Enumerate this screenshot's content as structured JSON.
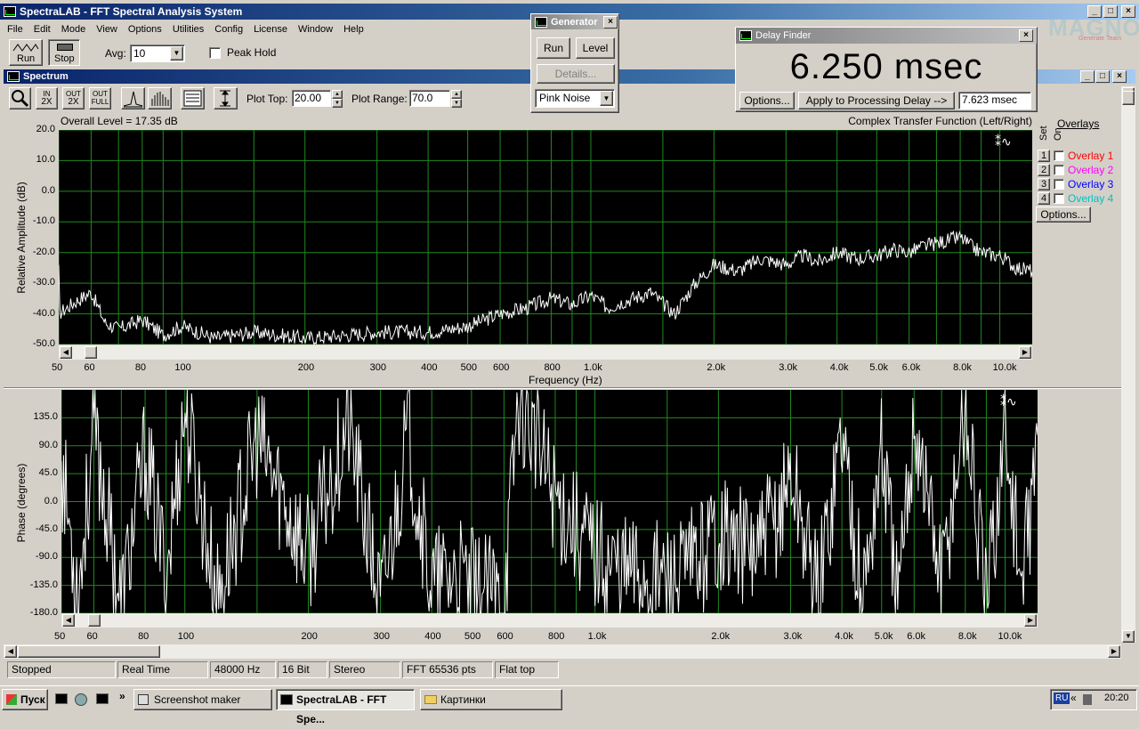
{
  "app": {
    "title": "SpectraLAB - FFT Spectral Analysis System",
    "watermark": "MAGNOLIA",
    "watermark_sub": "Generate Team"
  },
  "menu": [
    "File",
    "Edit",
    "Mode",
    "View",
    "Options",
    "Utilities",
    "Config",
    "License",
    "Window",
    "Help"
  ],
  "toolbar": {
    "run_label": "Run",
    "stop_label": "Stop",
    "avg_label": "Avg:",
    "avg_value": "10",
    "peak_hold_label": "Peak Hold"
  },
  "generator": {
    "title": "Generator",
    "run_label": "Run",
    "level_label": "Level",
    "details_label": "Details...",
    "signal_type": "Pink Noise"
  },
  "delay_finder": {
    "title": "Delay Finder",
    "readout": "6.250 msec",
    "options_label": "Options...",
    "apply_label": "Apply to Processing Delay -->",
    "value": "7.623 msec"
  },
  "spectrum": {
    "title": "Spectrum",
    "plot_top_label": "Plot Top:",
    "plot_top_value": "20.00",
    "plot_range_label": "Plot Range:",
    "plot_range_value": "70.0",
    "zoom_labels": {
      "in": "IN",
      "out": "OUT",
      "full": "FULL",
      "x2": "2X"
    },
    "overall_level": "Overall Level = 17.35 dB",
    "mode": "Complex Transfer Function (Left/Right)",
    "overlays": {
      "title": "Overlays",
      "set_label": "Set",
      "on_label": "On",
      "items": [
        {
          "num": "1",
          "label": "Overlay 1",
          "color": "#ff0000"
        },
        {
          "num": "2",
          "label": "Overlay 2",
          "color": "#ff00ff"
        },
        {
          "num": "3",
          "label": "Overlay 3",
          "color": "#0000ff"
        },
        {
          "num": "4",
          "label": "Overlay 4",
          "color": "#00c0c0"
        }
      ],
      "options_label": "Options..."
    }
  },
  "chart_data": [
    {
      "type": "line",
      "ylabel": "Relative Amplitude (dB)",
      "xlabel": "Frequency (Hz)",
      "xscale": "log",
      "xlim": [
        50,
        12000
      ],
      "ylim": [
        -50,
        20
      ],
      "yticks": [
        "20.0",
        "10.0",
        "0.0",
        "-10.0",
        "-20.0",
        "-30.0",
        "-40.0",
        "-50.0"
      ],
      "xticks": [
        "50",
        "60",
        "80",
        "100",
        "200",
        "300",
        "400",
        "500",
        "600",
        "800",
        "1.0k",
        "2.0k",
        "3.0k",
        "4.0k",
        "5.0k",
        "6.0k",
        "8.0k",
        "10.0k"
      ],
      "grid": true,
      "background": "#000000",
      "gridcolor": "#1f8a1f",
      "linecolor": "#ffffff",
      "series": [
        {
          "x": [
            50,
            55,
            60,
            65,
            70,
            80,
            90,
            100,
            120,
            150,
            200,
            250,
            300,
            350,
            400,
            450,
            500,
            550,
            600,
            700,
            800,
            900,
            1000,
            1100,
            1200,
            1400,
            1600,
            1800,
            2000,
            2300,
            2600,
            3000,
            3300,
            3600,
            4000,
            4500,
            5000,
            5500,
            6000,
            6500,
            7000,
            7500,
            8000,
            8500,
            9000,
            10000,
            11000,
            12000
          ],
          "y": [
            -40,
            -36,
            -33,
            -43,
            -45,
            -42,
            -47,
            -44,
            -48,
            -46,
            -48,
            -47,
            -46,
            -46,
            -46,
            -45,
            -44,
            -42,
            -40,
            -38,
            -35,
            -37,
            -34,
            -38,
            -36,
            -33,
            -40,
            -30,
            -24,
            -26,
            -22,
            -24,
            -21,
            -23,
            -20,
            -22,
            -21,
            -19,
            -20,
            -18,
            -17,
            -16,
            -15,
            -18,
            -20,
            -21,
            -25,
            -26
          ]
        }
      ]
    },
    {
      "type": "line",
      "ylabel": "Phase (degrees)",
      "xscale": "log",
      "xlim": [
        50,
        12000
      ],
      "ylim": [
        -180,
        180
      ],
      "yticks": [
        "135.0",
        "90.0",
        "45.0",
        "0.0",
        "-45.0",
        "-90.0",
        "-135.0",
        "-180.0"
      ],
      "xticks": [
        "50",
        "60",
        "80",
        "100",
        "200",
        "300",
        "400",
        "500",
        "600",
        "800",
        "1.0k",
        "2.0k",
        "3.0k",
        "4.0k",
        "5.0k",
        "6.0k",
        "8.0k",
        "10.0k"
      ],
      "grid": true,
      "background": "#000000",
      "gridcolor": "#1f8a1f",
      "linecolor": "#ffffff",
      "series": [
        {
          "x": [
            50,
            55,
            60,
            70,
            80,
            90,
            100,
            120,
            150,
            200,
            250,
            300,
            350,
            400,
            450,
            500,
            550,
            600,
            650,
            700,
            750,
            800,
            900,
            1000,
            1100,
            1200,
            1400,
            1600,
            1800,
            2000,
            2200,
            2500,
            2800,
            3000,
            3500,
            4000,
            4500,
            5000,
            5500,
            6000,
            7000,
            8000,
            9000,
            10000,
            11000,
            12000
          ],
          "y": [
            60,
            -150,
            120,
            -170,
            80,
            -120,
            150,
            -160,
            100,
            -90,
            130,
            -170,
            110,
            -140,
            -120,
            -140,
            -150,
            -160,
            170,
            120,
            60,
            10,
            -40,
            -80,
            -100,
            -110,
            -120,
            -130,
            -90,
            -40,
            -70,
            -80,
            -20,
            50,
            -150,
            120,
            -160,
            90,
            -170,
            140,
            -130,
            160,
            -170,
            120,
            -150,
            100
          ]
        }
      ]
    }
  ],
  "status_bar": [
    "Stopped",
    "Real Time",
    "48000 Hz",
    "16 Bit",
    "Stereo",
    "FFT 65536 pts",
    "Flat top"
  ],
  "taskbar": {
    "start": "Пуск",
    "items": [
      "Screenshot maker",
      "SpectraLAB - FFT Spe...",
      "Картинки"
    ],
    "lang": "RU",
    "time": "20:20"
  }
}
